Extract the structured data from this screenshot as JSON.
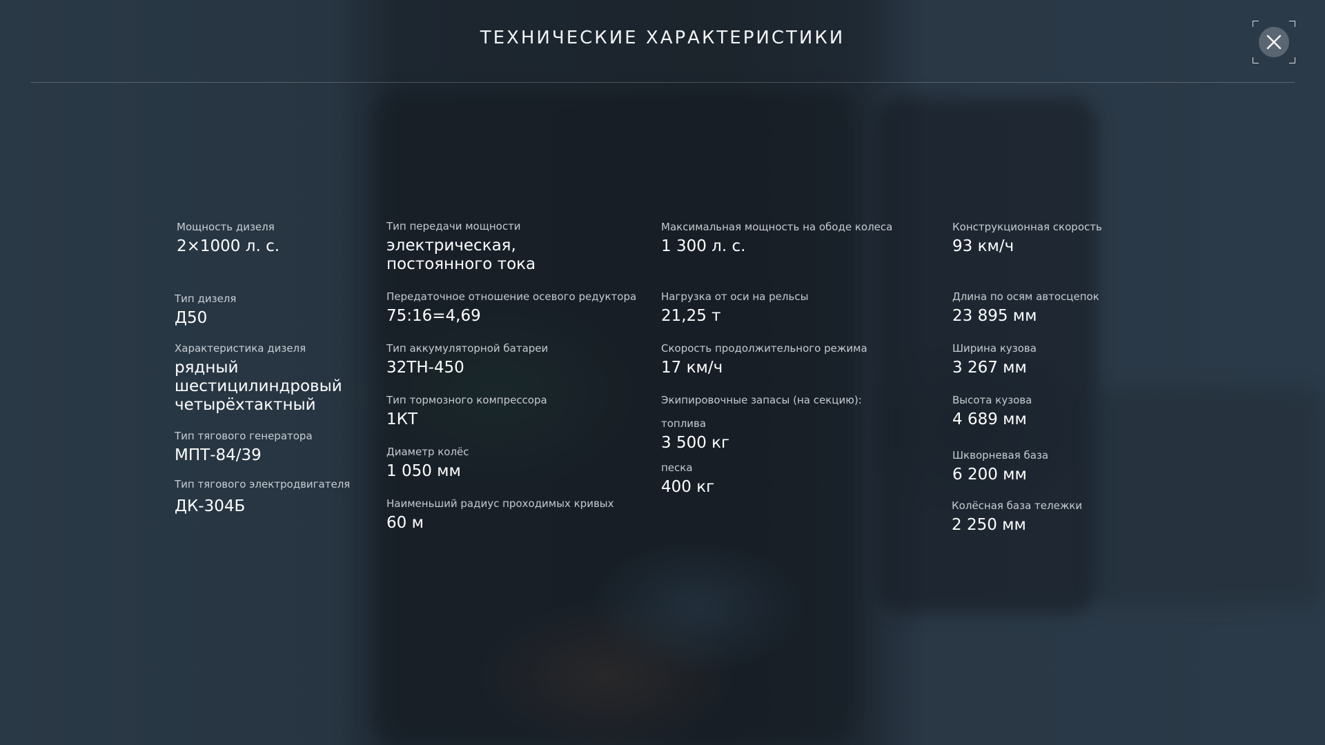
{
  "title": "ТЕХНИЧЕСКИЕ ХАРАКТЕРИСТИКИ",
  "close_icon": "close-icon",
  "colors": {
    "background": "#253340",
    "text": "#ffffff",
    "label": "#e4e8ec",
    "close_button": "#828c96"
  },
  "specs": {
    "col1": [
      {
        "label": "Мощность дизеля",
        "value": "2×1000 л. с."
      },
      {
        "label": "Тип дизеля",
        "value": "Д50"
      },
      {
        "label": "Характеристика дизеля",
        "value": "рядный\nшестицилиндровый\nчетырёхтактный"
      },
      {
        "label": "Тип тягового генератора",
        "value": "МПТ-84/39"
      },
      {
        "label": "Тип тягового электродвигателя",
        "value": "ДК-304Б"
      }
    ],
    "col2": [
      {
        "label": "Тип передачи мощности",
        "value": "электрическая,\nпостоянного тока"
      },
      {
        "label": "Передаточное отношение осевого редуктора",
        "value": "75:16=4,69"
      },
      {
        "label": "Тип аккумуляторной батареи",
        "value": "32ТН-450"
      },
      {
        "label": "Тип тормозного компрессора",
        "value": "1КТ"
      },
      {
        "label": "Диаметр колёс",
        "value": "1 050 мм"
      },
      {
        "label": "Наименьший радиус проходимых кривых",
        "value": "60 м"
      }
    ],
    "col3": [
      {
        "label": "Максимальная мощность на ободе колеса",
        "value": "1 300 л. с."
      },
      {
        "label": "Нагрузка от оси на рельсы",
        "value": "21,25 т"
      },
      {
        "label": "Скорость продолжительного режима",
        "value": "17 км/ч"
      },
      {
        "label": "Экипировочные запасы (на секцию):"
      },
      {
        "label": "топлива",
        "value": "3 500 кг"
      },
      {
        "label": "песка",
        "value": "400 кг"
      }
    ],
    "col4": [
      {
        "label": "Конструкционная скорость",
        "value": "93 км/ч"
      },
      {
        "label": "Длина по осям автосцепок",
        "value": "23 895 мм"
      },
      {
        "label": "Ширина кузова",
        "value": "3 267 мм"
      },
      {
        "label": "Высота кузова",
        "value": "4 689 мм"
      },
      {
        "label": "Шкворневая база",
        "value": "6 200 мм"
      },
      {
        "label": "Колёсная база тележки",
        "value": "2 250 мм"
      }
    ]
  }
}
